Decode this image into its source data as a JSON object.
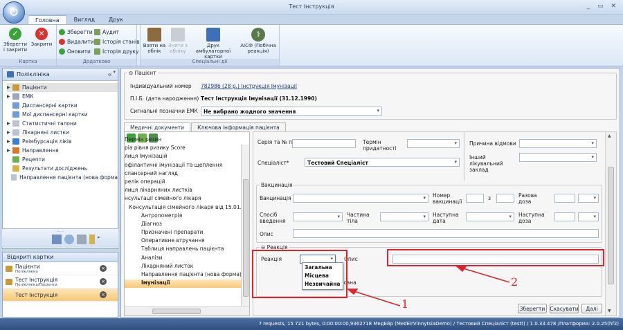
{
  "window": {
    "title": "Тест Інструкція",
    "controls": "_ ▭ ✕"
  },
  "ribbon": {
    "tabs": [
      "Головна",
      "Вигляд",
      "Друк"
    ],
    "groups": {
      "card": {
        "label": "Картка",
        "save_close": "Зберегти і закрити",
        "close": "Закрити"
      },
      "extra": {
        "label": "Додатково",
        "save": "Зберегти",
        "delete": "Видалити",
        "refresh": "Оновити",
        "audit": "Аудит",
        "state_history": "Історія станів",
        "print_history": "Історія друку"
      },
      "special": {
        "label": "Спеціальні дії",
        "take_record": "Взяти на облік",
        "remove_record": "Зняти з обліку",
        "print_card": "Друк амбулаторної картки",
        "aisf": "АІСФ (Побічна реакція)"
      }
    }
  },
  "left_panel": {
    "title": "Поліклініка",
    "collapse": "«",
    "tree": [
      {
        "label": "Пацієнти",
        "arrow": true,
        "selected": true,
        "color": "#c79a3b"
      },
      {
        "label": "ЕМК",
        "arrow": true,
        "selected": false,
        "color": "#9aa8ba"
      },
      {
        "label": "Диспансерні картки",
        "arrow": false,
        "selected": false,
        "color": "#6f9ed6"
      },
      {
        "label": "Мої диспансерні картки",
        "arrow": false,
        "selected": false,
        "color": "#6f9ed6"
      },
      {
        "label": "Статистичні талони",
        "arrow": true,
        "selected": false,
        "color": "#b9c4d2"
      },
      {
        "label": "Лікарняні листки",
        "arrow": true,
        "selected": false,
        "color": "#b9c4d2"
      },
      {
        "label": "Реімбурсація ліків",
        "arrow": true,
        "selected": false,
        "color": "#3c7dd1"
      },
      {
        "label": "Направлення",
        "arrow": true,
        "selected": false,
        "color": "#d47a2a"
      },
      {
        "label": "Рецепти",
        "arrow": false,
        "selected": false,
        "color": "#6fb04f"
      },
      {
        "label": "Результати досліджень",
        "arrow": false,
        "selected": false,
        "color": "#d6b24a"
      },
      {
        "label": "Направлення пацієнта (нова форма",
        "arrow": false,
        "selected": false,
        "color": "#b9c4d2"
      }
    ],
    "grip": "....."
  },
  "open_cards": {
    "title": "Відкриті картки",
    "items": [
      {
        "title": "Пацієнти",
        "sub": "Поліклініка",
        "active": false
      },
      {
        "title": "Тест Інструкція",
        "sub": "Поліклініка/Пацієнти",
        "active": false
      },
      {
        "title": "Тест Інструкція",
        "sub": "",
        "active": true
      }
    ],
    "close_glyph": "×"
  },
  "patient": {
    "section": "Пацієнт",
    "id_label": "Індивідуальний номер",
    "id_value": "782986 (28 р.) Інструкція Імунізації",
    "name_label": "П.І.Б. (дата народження)",
    "name_value": "Тест Інструкція Імунізації (31.12.1990)",
    "signals_label": "Сигнальні позначки ЕМК",
    "signals_value": "Не вибрано жодного значення"
  },
  "doc_tabs": [
    "Медичні документи",
    "Ключова інформація пацієнта"
  ],
  "doc_list": [
    {
      "label": "Пермін резин",
      "sub": false,
      "hl": false
    },
    {
      "label": "ріа рівня ризику Score",
      "sub": false,
      "hl": false
    },
    {
      "label": "лиця Імунізацій",
      "sub": false,
      "hl": false
    },
    {
      "label": "офілактичні імунізації та щеплення",
      "sub": false,
      "hl": false
    },
    {
      "label": "спансерний нагляд",
      "sub": false,
      "hl": false
    },
    {
      "label": "релік операцій",
      "sub": false,
      "hl": false
    },
    {
      "label": "лиця лікарняних листків",
      "sub": false,
      "hl": false
    },
    {
      "label": "нсультації сімейного лікаря",
      "sub": false,
      "hl": false
    },
    {
      "label": "Консультація сімейного лікаря від 15.01.2019",
      "sub": false,
      "hl": false
    },
    {
      "label": "Антропометрія",
      "sub": true,
      "hl": false
    },
    {
      "label": "Діагноз",
      "sub": true,
      "hl": false
    },
    {
      "label": "Призначені препарати",
      "sub": true,
      "hl": false
    },
    {
      "label": "Оперативне втручання",
      "sub": true,
      "hl": false
    },
    {
      "label": "Таблиця направлень пацієнта",
      "sub": true,
      "hl": false
    },
    {
      "label": "Аналізи",
      "sub": true,
      "hl": false
    },
    {
      "label": "Лікарняний листок",
      "sub": true,
      "hl": false
    },
    {
      "label": "Направлення пацієнта (нова форма)",
      "sub": true,
      "hl": false
    },
    {
      "label": "Імунізації",
      "sub": true,
      "hl": true
    }
  ],
  "form": {
    "series_label": "Серія та № партії",
    "term_label": "Термін придатності",
    "cause_label": "Причина відмови",
    "specialist_label": "Спеціаліст*",
    "specialist_value": "Тестовий Спеціаліст",
    "other_inst_label": "Інший лікувальний заклад",
    "vaccination_section": "Вакцинація",
    "vaccination_label": "Вакцинація",
    "vac_number_label": "Номер вакцинації",
    "of_label": "з",
    "single_dose_label": "Разова доза",
    "method_label": "Спосіб введення",
    "body_part_label": "Частина тіла",
    "next_date_label": "Наступна дата",
    "next_dose_label": "Наступна доза",
    "desc_label": "Опис",
    "reaction_section": "Реакція",
    "reaction_label": "Реакція",
    "reaction_desc_label": "Опис",
    "consent_label": "Згода підписана",
    "reaction_options": [
      "Загальна",
      "Місцева",
      "Незвичайна"
    ]
  },
  "buttons": {
    "save": "Зберегти",
    "cancel": "Скасувати",
    "next": "Далі"
  },
  "annotations": {
    "n1": "1",
    "n2": "2",
    "color": "#e0242b"
  },
  "status": "7 requests, 15 721 bytes, 0:00:00:00,9362718  МедЕйр (MedEirVinnytsiaDemo) / Тестовий Спеціаліст (testt) / 1.0.33.478 /Платформа: 2.0.25(hf2)"
}
